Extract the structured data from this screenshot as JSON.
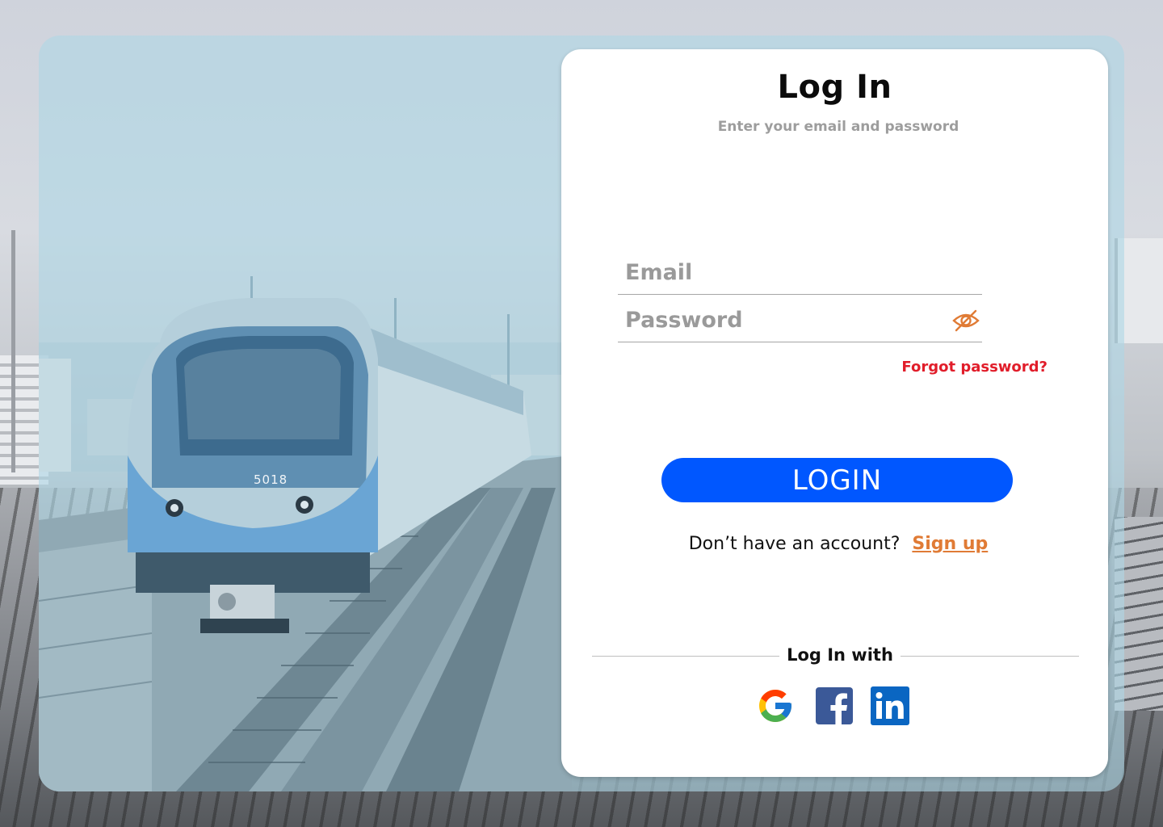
{
  "login": {
    "title": "Log In",
    "subtitle": "Enter your email and password",
    "email_placeholder": "Email",
    "password_placeholder": "Password",
    "forgot_password": "Forgot password?",
    "login_button": "LOGIN",
    "no_account_text": "Don’t have an account?",
    "signup_link": "Sign up",
    "social_divider": "Log In with"
  },
  "social": [
    {
      "icon": "google-icon"
    },
    {
      "icon": "facebook-icon"
    },
    {
      "icon": "linkedin-icon"
    }
  ],
  "background": {
    "train_number": "5018"
  },
  "colors": {
    "primary_button": "#0057ff",
    "forgot_link": "#e11d2a",
    "signup_link": "#e07b35",
    "eye_icon": "#e07b35",
    "overlay_tint": "#aed6e5"
  }
}
